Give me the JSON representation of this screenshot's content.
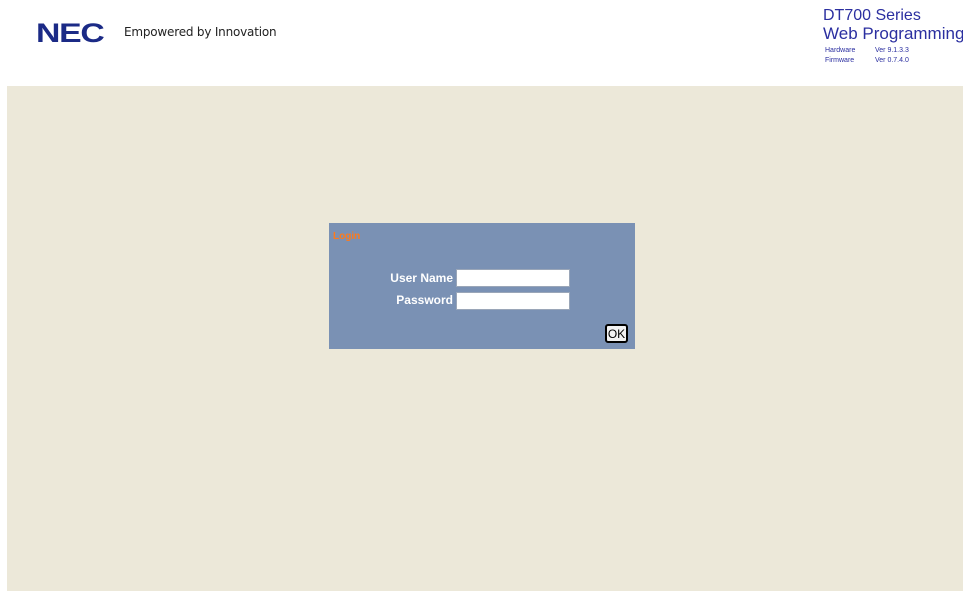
{
  "header": {
    "logo_text": "NEC",
    "tagline": "Empowered by Innovation",
    "product_title": "DT700 Series",
    "product_subtitle": "Web Programming",
    "versions": [
      {
        "label": "Hardware",
        "value": "Ver 9.1.3.3"
      },
      {
        "label": "Firmware",
        "value": "Ver 0.7.4.0"
      }
    ],
    "brand_color": "#1b2a86",
    "title_color": "#2b2fa0"
  },
  "login": {
    "title": "Login",
    "username_label": "User Name",
    "username_value": "",
    "password_label": "Password",
    "password_value": "",
    "ok_label": "OK",
    "panel_color": "#7a91b4",
    "title_color": "#ff7a1a"
  },
  "main": {
    "background_color": "#ece8d9"
  }
}
